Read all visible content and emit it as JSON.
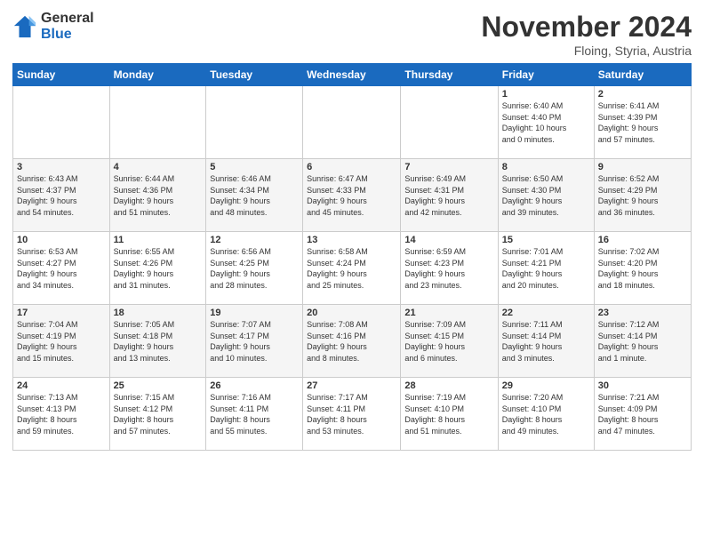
{
  "header": {
    "logo_general": "General",
    "logo_blue": "Blue",
    "month_title": "November 2024",
    "location": "Floing, Styria, Austria"
  },
  "columns": [
    "Sunday",
    "Monday",
    "Tuesday",
    "Wednesday",
    "Thursday",
    "Friday",
    "Saturday"
  ],
  "weeks": [
    [
      {
        "day": "",
        "info": ""
      },
      {
        "day": "",
        "info": ""
      },
      {
        "day": "",
        "info": ""
      },
      {
        "day": "",
        "info": ""
      },
      {
        "day": "",
        "info": ""
      },
      {
        "day": "1",
        "info": "Sunrise: 6:40 AM\nSunset: 4:40 PM\nDaylight: 10 hours\nand 0 minutes."
      },
      {
        "day": "2",
        "info": "Sunrise: 6:41 AM\nSunset: 4:39 PM\nDaylight: 9 hours\nand 57 minutes."
      }
    ],
    [
      {
        "day": "3",
        "info": "Sunrise: 6:43 AM\nSunset: 4:37 PM\nDaylight: 9 hours\nand 54 minutes."
      },
      {
        "day": "4",
        "info": "Sunrise: 6:44 AM\nSunset: 4:36 PM\nDaylight: 9 hours\nand 51 minutes."
      },
      {
        "day": "5",
        "info": "Sunrise: 6:46 AM\nSunset: 4:34 PM\nDaylight: 9 hours\nand 48 minutes."
      },
      {
        "day": "6",
        "info": "Sunrise: 6:47 AM\nSunset: 4:33 PM\nDaylight: 9 hours\nand 45 minutes."
      },
      {
        "day": "7",
        "info": "Sunrise: 6:49 AM\nSunset: 4:31 PM\nDaylight: 9 hours\nand 42 minutes."
      },
      {
        "day": "8",
        "info": "Sunrise: 6:50 AM\nSunset: 4:30 PM\nDaylight: 9 hours\nand 39 minutes."
      },
      {
        "day": "9",
        "info": "Sunrise: 6:52 AM\nSunset: 4:29 PM\nDaylight: 9 hours\nand 36 minutes."
      }
    ],
    [
      {
        "day": "10",
        "info": "Sunrise: 6:53 AM\nSunset: 4:27 PM\nDaylight: 9 hours\nand 34 minutes."
      },
      {
        "day": "11",
        "info": "Sunrise: 6:55 AM\nSunset: 4:26 PM\nDaylight: 9 hours\nand 31 minutes."
      },
      {
        "day": "12",
        "info": "Sunrise: 6:56 AM\nSunset: 4:25 PM\nDaylight: 9 hours\nand 28 minutes."
      },
      {
        "day": "13",
        "info": "Sunrise: 6:58 AM\nSunset: 4:24 PM\nDaylight: 9 hours\nand 25 minutes."
      },
      {
        "day": "14",
        "info": "Sunrise: 6:59 AM\nSunset: 4:23 PM\nDaylight: 9 hours\nand 23 minutes."
      },
      {
        "day": "15",
        "info": "Sunrise: 7:01 AM\nSunset: 4:21 PM\nDaylight: 9 hours\nand 20 minutes."
      },
      {
        "day": "16",
        "info": "Sunrise: 7:02 AM\nSunset: 4:20 PM\nDaylight: 9 hours\nand 18 minutes."
      }
    ],
    [
      {
        "day": "17",
        "info": "Sunrise: 7:04 AM\nSunset: 4:19 PM\nDaylight: 9 hours\nand 15 minutes."
      },
      {
        "day": "18",
        "info": "Sunrise: 7:05 AM\nSunset: 4:18 PM\nDaylight: 9 hours\nand 13 minutes."
      },
      {
        "day": "19",
        "info": "Sunrise: 7:07 AM\nSunset: 4:17 PM\nDaylight: 9 hours\nand 10 minutes."
      },
      {
        "day": "20",
        "info": "Sunrise: 7:08 AM\nSunset: 4:16 PM\nDaylight: 9 hours\nand 8 minutes."
      },
      {
        "day": "21",
        "info": "Sunrise: 7:09 AM\nSunset: 4:15 PM\nDaylight: 9 hours\nand 6 minutes."
      },
      {
        "day": "22",
        "info": "Sunrise: 7:11 AM\nSunset: 4:14 PM\nDaylight: 9 hours\nand 3 minutes."
      },
      {
        "day": "23",
        "info": "Sunrise: 7:12 AM\nSunset: 4:14 PM\nDaylight: 9 hours\nand 1 minute."
      }
    ],
    [
      {
        "day": "24",
        "info": "Sunrise: 7:13 AM\nSunset: 4:13 PM\nDaylight: 8 hours\nand 59 minutes."
      },
      {
        "day": "25",
        "info": "Sunrise: 7:15 AM\nSunset: 4:12 PM\nDaylight: 8 hours\nand 57 minutes."
      },
      {
        "day": "26",
        "info": "Sunrise: 7:16 AM\nSunset: 4:11 PM\nDaylight: 8 hours\nand 55 minutes."
      },
      {
        "day": "27",
        "info": "Sunrise: 7:17 AM\nSunset: 4:11 PM\nDaylight: 8 hours\nand 53 minutes."
      },
      {
        "day": "28",
        "info": "Sunrise: 7:19 AM\nSunset: 4:10 PM\nDaylight: 8 hours\nand 51 minutes."
      },
      {
        "day": "29",
        "info": "Sunrise: 7:20 AM\nSunset: 4:10 PM\nDaylight: 8 hours\nand 49 minutes."
      },
      {
        "day": "30",
        "info": "Sunrise: 7:21 AM\nSunset: 4:09 PM\nDaylight: 8 hours\nand 47 minutes."
      }
    ]
  ]
}
